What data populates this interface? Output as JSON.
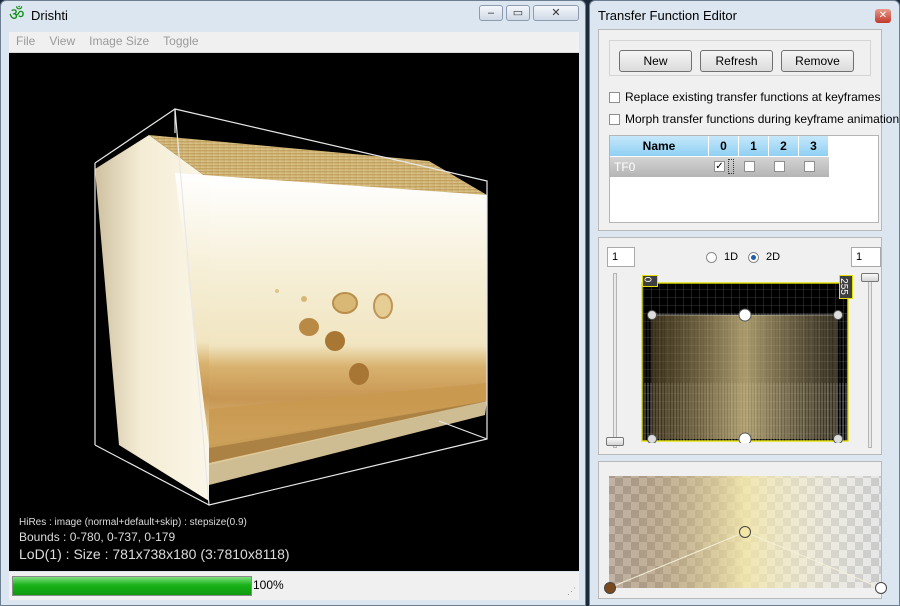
{
  "main_window": {
    "title": "Drishti",
    "menu": [
      "File",
      "View",
      "Image Size",
      "Toggle"
    ],
    "info": {
      "line1": "HiRes : image (normal+default+skip) : stepsize(0.9)",
      "line2": "Bounds : 0-780, 0-737, 0-179",
      "line3": "LoD(1) : Size : 781x738x180 (3:7810x8118)"
    },
    "progress": {
      "value": 1.0,
      "label": "100%"
    }
  },
  "tf_editor": {
    "title": "Transfer Function Editor",
    "buttons": {
      "new": "New",
      "refresh": "Refresh",
      "remove": "Remove"
    },
    "options": {
      "replace": "Replace existing transfer functions at keyframes",
      "morph": "Morph transfer functions during keyframe animation"
    },
    "table": {
      "headers": [
        "Name",
        "0",
        "1",
        "2",
        "3"
      ],
      "rows": [
        {
          "name": "TF0",
          "checks": [
            true,
            false,
            false,
            false
          ]
        }
      ]
    },
    "controls": {
      "left_value": "1",
      "right_value": "1",
      "mode_1d": "1D",
      "mode_2d": "2D",
      "selected_mode": "2D",
      "range_min": "0",
      "range_max": "255"
    }
  },
  "colors": {
    "window_frame": "#dce6f1",
    "header_blue": "#8fd0f3",
    "progress_green": "#19b219",
    "tf_highlight": "#e3e000",
    "node_dark": "#7a4a1e",
    "node_light": "#f3e6a6"
  }
}
